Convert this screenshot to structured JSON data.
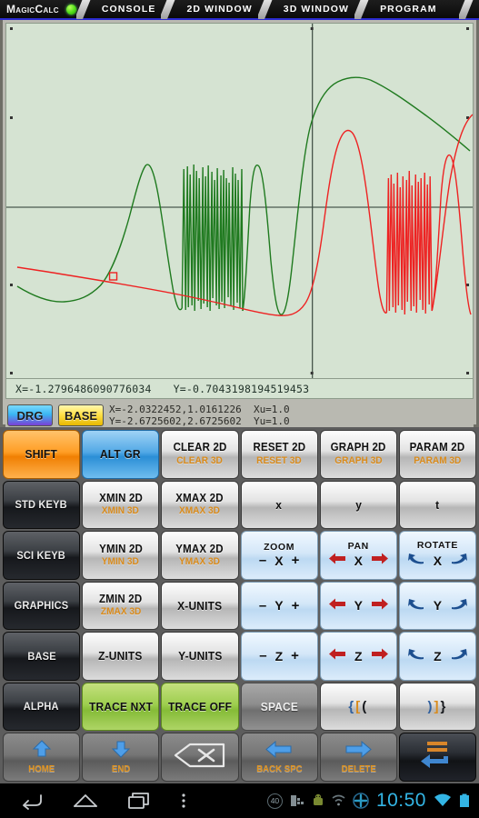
{
  "titlebar": {
    "brand": "MagicCalc",
    "tabs": [
      {
        "label": "CONSOLE"
      },
      {
        "label": "2D WINDOW"
      },
      {
        "label": "3D WINDOW"
      },
      {
        "label": "PROGRAM"
      }
    ]
  },
  "plot": {
    "bg_color": "#d5e3d2",
    "curve_colors": {
      "green": "#1f7a1f",
      "red": "#ee2222"
    },
    "trace_readout": {
      "x": "X=-1.2796486090776034",
      "y": "Y=-0.7043198194519453"
    },
    "window": {
      "line1": "X=-2.0322452,1.0161226  Xu=1.0",
      "line2": "Y=-2.6725602,2.6725602  Yu=1.0"
    },
    "mode_buttons": [
      {
        "label": "DRG"
      },
      {
        "label": "BASE"
      }
    ]
  },
  "chart_data": {
    "type": "line",
    "title": "",
    "xlabel": "",
    "ylabel": "",
    "xlim": [
      -2.0322452,
      1.0161226
    ],
    "ylim": [
      -2.6725602,
      2.6725602
    ],
    "x_unit": 1.0,
    "y_unit": 1.0,
    "grid": false,
    "axes_shown": true,
    "trace_cursor": {
      "x": -1.2796486090776034,
      "y": -0.7043198194519453
    },
    "series": [
      {
        "name": "green",
        "color": "#1f7a1f",
        "description": "oscillatory curve with dense high-frequency burst left of center, smooth sigmoid rise to plateau near x=-0.2, then slow decline to the right"
      },
      {
        "name": "red",
        "color": "#ee2222",
        "description": "slow decline from upper-left, flat trough, sharp rise near x=-0.15 with dense high-frequency burst at origin, then rise to plateau on the far right"
      }
    ]
  },
  "keypad": {
    "rows": [
      [
        {
          "name": "shift",
          "label": "SHIFT",
          "style": "k-orange"
        },
        {
          "name": "alt-gr",
          "label": "ALT GR",
          "style": "k-blue"
        },
        {
          "name": "clear",
          "label": "CLEAR 2D",
          "sub": "CLEAR 3D",
          "style": "k-grey"
        },
        {
          "name": "reset",
          "label": "RESET 2D",
          "sub": "RESET 3D",
          "style": "k-grey"
        },
        {
          "name": "graph",
          "label": "GRAPH 2D",
          "sub": "GRAPH 3D",
          "style": "k-grey"
        },
        {
          "name": "param",
          "label": "PARAM 2D",
          "sub": "PARAM 3D",
          "style": "k-grey"
        }
      ],
      [
        {
          "name": "std-keyb",
          "label": "STD KEYB",
          "style": "k-dark"
        },
        {
          "name": "xmin",
          "label": "XMIN 2D",
          "sub": "XMIN 3D",
          "style": "k-grey"
        },
        {
          "name": "xmax",
          "label": "XMAX 2D",
          "sub": "XMAX 3D",
          "style": "k-grey"
        },
        {
          "name": "var-x",
          "label": "x",
          "style": "k-grey"
        },
        {
          "name": "var-y",
          "label": "y",
          "style": "k-grey"
        },
        {
          "name": "var-t",
          "label": "t",
          "style": "k-grey"
        }
      ],
      [
        {
          "name": "sci-keyb",
          "label": "SCI KEYB",
          "style": "k-dark"
        },
        {
          "name": "ymin",
          "label": "YMIN 2D",
          "sub": "YMIN 3D",
          "style": "k-grey"
        },
        {
          "name": "ymax",
          "label": "YMAX 2D",
          "sub": "YMAX 3D",
          "style": "k-grey"
        },
        {
          "name": "zoom-x",
          "cap": "ZOOM",
          "axis": "X",
          "kind": "zoom",
          "style": "k-lblue"
        },
        {
          "name": "pan-x",
          "cap": "PAN",
          "axis": "X",
          "kind": "pan",
          "style": "k-lblue"
        },
        {
          "name": "rotate-x",
          "cap": "ROTATE",
          "axis": "X",
          "kind": "rotate",
          "style": "k-lblue"
        }
      ],
      [
        {
          "name": "graphics",
          "label": "GRAPHICS",
          "style": "k-dark"
        },
        {
          "name": "zmin",
          "label": "ZMIN 2D",
          "sub": "ZMAX 3D",
          "style": "k-grey"
        },
        {
          "name": "x-units",
          "label": "X-UNITS",
          "style": "k-grey"
        },
        {
          "name": "zoom-y",
          "cap": "",
          "axis": "Y",
          "kind": "zoom",
          "style": "k-lblue"
        },
        {
          "name": "pan-y",
          "cap": "",
          "axis": "Y",
          "kind": "pan",
          "style": "k-lblue"
        },
        {
          "name": "rotate-y",
          "cap": "",
          "axis": "Y",
          "kind": "rotate",
          "style": "k-lblue"
        }
      ],
      [
        {
          "name": "base",
          "label": "BASE",
          "style": "k-dark"
        },
        {
          "name": "z-units",
          "label": "Z-UNITS",
          "style": "k-grey"
        },
        {
          "name": "y-units",
          "label": "Y-UNITS",
          "style": "k-grey"
        },
        {
          "name": "zoom-z",
          "cap": "",
          "axis": "Z",
          "kind": "zoom",
          "style": "k-lblue"
        },
        {
          "name": "pan-z",
          "cap": "",
          "axis": "Z",
          "kind": "pan",
          "style": "k-lblue"
        },
        {
          "name": "rotate-z",
          "cap": "",
          "axis": "Z",
          "kind": "rotate",
          "style": "k-lblue"
        }
      ],
      [
        {
          "name": "alpha",
          "label": "ALPHA",
          "style": "k-dark"
        },
        {
          "name": "trace-nxt",
          "label": "TRACE NXT",
          "style": "k-green"
        },
        {
          "name": "trace-off",
          "label": "TRACE OFF",
          "style": "k-green"
        },
        {
          "name": "space",
          "label": "SPACE",
          "style": "k-space"
        },
        {
          "name": "open-brackets",
          "kind": "brackets",
          "b1": "{",
          "b2": "[",
          "b3": "(",
          "style": "k-grey"
        },
        {
          "name": "close-brackets",
          "kind": "brackets",
          "b1": ")",
          "b2": "]",
          "b3": "}",
          "style": "k-grey"
        }
      ],
      [
        {
          "name": "home",
          "kind": "nav",
          "icon": "arrow-up-icon",
          "sub": "HOME",
          "style": "k-nav"
        },
        {
          "name": "end",
          "kind": "nav",
          "icon": "arrow-down-icon",
          "sub": "END",
          "style": "k-nav"
        },
        {
          "name": "backspace",
          "kind": "nav",
          "icon": "backspace-icon",
          "sub": "",
          "style": "k-nav"
        },
        {
          "name": "back-spc",
          "kind": "nav",
          "icon": "arrow-left-icon",
          "sub": "BACK SPC",
          "style": "k-nav"
        },
        {
          "name": "delete",
          "kind": "nav",
          "icon": "arrow-right-icon",
          "sub": "DELETE",
          "style": "k-nav"
        },
        {
          "name": "enter",
          "kind": "enter",
          "icon": "enter-icon",
          "style": "k-enter"
        }
      ]
    ]
  },
  "navbar": {
    "buttons": [
      {
        "name": "back-icon"
      },
      {
        "name": "home-icon"
      },
      {
        "name": "recents-icon"
      },
      {
        "name": "menu-icon"
      }
    ],
    "status": {
      "badge_count": "40",
      "clock": "10:50"
    }
  }
}
